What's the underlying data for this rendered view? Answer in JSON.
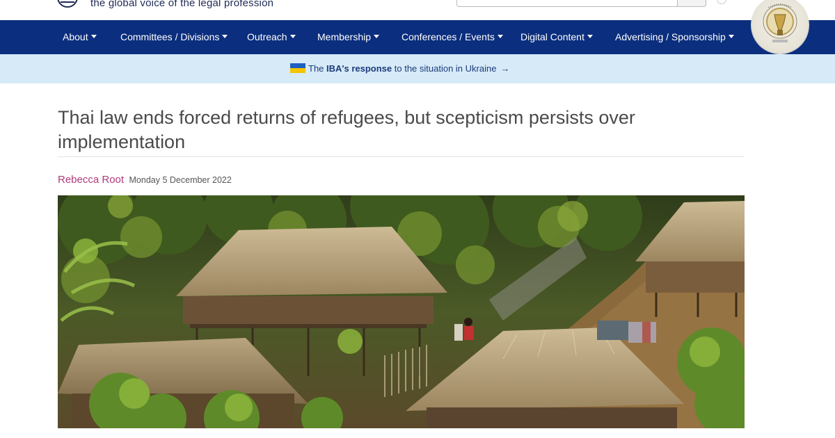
{
  "header": {
    "tagline": "the global voice of the legal profession",
    "logo_icon": "iba-globe-icon",
    "search_icon": "search-icon"
  },
  "nav": {
    "items": [
      {
        "label": "About"
      },
      {
        "label": "Committees / Divisions"
      },
      {
        "label": "Outreach"
      },
      {
        "label": "Membership"
      },
      {
        "label": "Conferences / Events"
      },
      {
        "label": "Digital Content"
      },
      {
        "label": "Advertising / Sponsorship"
      }
    ],
    "background": "#0b2e7e"
  },
  "banner": {
    "prefix": "The ",
    "strong": "IBA's response",
    "suffix": " to the situation in Ukraine",
    "arrow": "→",
    "background": "#d6eaf8"
  },
  "article": {
    "title": "Thai law ends forced returns of refugees, but scepticism persists over implementation",
    "author": "Rebecca Root",
    "date": "Monday 5 December 2022",
    "image_icon": "refugee-camp-photo"
  },
  "colors": {
    "author": "#b03a7a",
    "title": "#4a4a4a"
  }
}
